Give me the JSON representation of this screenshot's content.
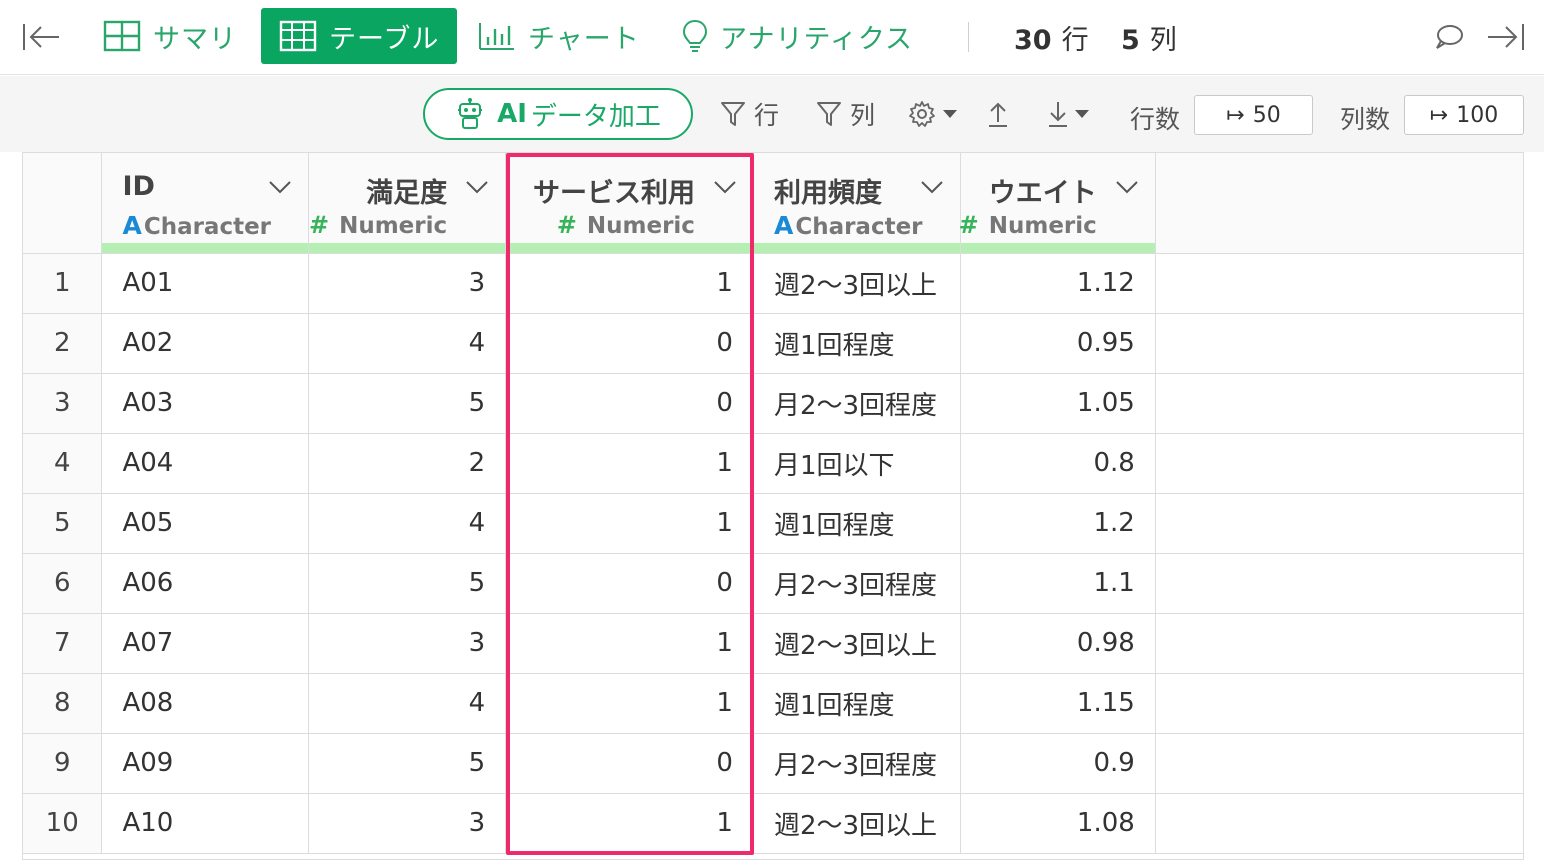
{
  "tabs": [
    {
      "label": "サマリ",
      "active": false
    },
    {
      "label": "テーブル",
      "active": true
    },
    {
      "label": "チャート",
      "active": false
    },
    {
      "label": "アナリティクス",
      "active": false
    }
  ],
  "counts": {
    "rows_value": "30",
    "rows_unit": "行",
    "cols_value": "5",
    "cols_unit": "列"
  },
  "toolbar": {
    "ai_strong": "AI",
    "ai_label": "データ加工",
    "filter_rows": "行",
    "filter_cols": "列",
    "rows_label": "行数",
    "rows_value": "50",
    "cols_label": "列数",
    "cols_value": "100"
  },
  "columns": [
    {
      "name": "ID",
      "type": "Character",
      "type_symbol": "A",
      "align": "left"
    },
    {
      "name": "満足度",
      "type": "Numeric",
      "type_symbol": "#",
      "align": "right"
    },
    {
      "name": "サービス利用",
      "type": "Numeric",
      "type_symbol": "#",
      "align": "right"
    },
    {
      "name": "利用頻度",
      "type": "Character",
      "type_symbol": "A",
      "align": "left"
    },
    {
      "name": "ウエイト",
      "type": "Numeric",
      "type_symbol": "#",
      "align": "right"
    }
  ],
  "rows": [
    {
      "n": "1",
      "cells": [
        "A01",
        "3",
        "1",
        "週2〜3回以上",
        "1.12"
      ]
    },
    {
      "n": "2",
      "cells": [
        "A02",
        "4",
        "0",
        "週1回程度",
        "0.95"
      ]
    },
    {
      "n": "3",
      "cells": [
        "A03",
        "5",
        "0",
        "月2〜3回程度",
        "1.05"
      ]
    },
    {
      "n": "4",
      "cells": [
        "A04",
        "2",
        "1",
        "月1回以下",
        "0.8"
      ]
    },
    {
      "n": "5",
      "cells": [
        "A05",
        "4",
        "1",
        "週1回程度",
        "1.2"
      ]
    },
    {
      "n": "6",
      "cells": [
        "A06",
        "5",
        "0",
        "月2〜3回程度",
        "1.1"
      ]
    },
    {
      "n": "7",
      "cells": [
        "A07",
        "3",
        "1",
        "週2〜3回以上",
        "0.98"
      ]
    },
    {
      "n": "8",
      "cells": [
        "A08",
        "4",
        "1",
        "週1回程度",
        "1.15"
      ]
    },
    {
      "n": "9",
      "cells": [
        "A09",
        "5",
        "0",
        "月2〜3回程度",
        "0.9"
      ]
    },
    {
      "n": "10",
      "cells": [
        "A10",
        "3",
        "1",
        "週2〜3回以上",
        "1.08"
      ]
    }
  ],
  "icons": {
    "collapse_left": "collapse-left-icon",
    "expand_right": "expand-right-icon",
    "comment": "comment-icon",
    "settings": "gear-icon",
    "sort_asc": "sort-ascending-icon",
    "sort_desc": "sort-descending-icon"
  },
  "colors": {
    "accent": "#0aa560",
    "highlight": "#ee2a6b",
    "character_type": "#1a8ad4",
    "numeric_type": "#37b35a",
    "type_bar": "#b5efb3"
  }
}
